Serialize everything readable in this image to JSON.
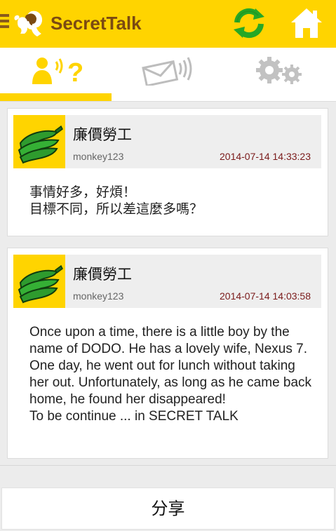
{
  "app": {
    "title": "SecretTalk",
    "accent_color": "#ffd400",
    "title_color": "#7b4a12"
  },
  "toolbar": {
    "menu_icon": "hamburger-menu-icon",
    "logo_icon": "silhouette-logo-icon",
    "refresh_icon": "refresh-icon",
    "home_icon": "home-icon"
  },
  "tabs": [
    {
      "icon": "who-is-talking-icon",
      "selected": true
    },
    {
      "icon": "message-envelope-icon",
      "selected": false
    },
    {
      "icon": "settings-gears-icon",
      "selected": false
    }
  ],
  "posts": [
    {
      "avatar_icon": "banana-avatar",
      "author": "廉價勞工",
      "handle": "monkey123",
      "time": "2014-07-14 14:33:23",
      "body": "事情好多，好煩！\n目標不同，所以差這麼多嗎？"
    },
    {
      "avatar_icon": "banana-avatar",
      "author": "廉價勞工",
      "handle": "monkey123",
      "time": "2014-07-14 14:03:58",
      "body": "Once upon a time, there is a little boy by the name of DODO. He has a lovely wife, Nexus 7. One day, he went out for lunch without taking her out. Unfortunately, as long as he came back home, he found her disappeared!\nTo be continue ... in SECRET TALK"
    }
  ],
  "share": {
    "label": "分享"
  }
}
